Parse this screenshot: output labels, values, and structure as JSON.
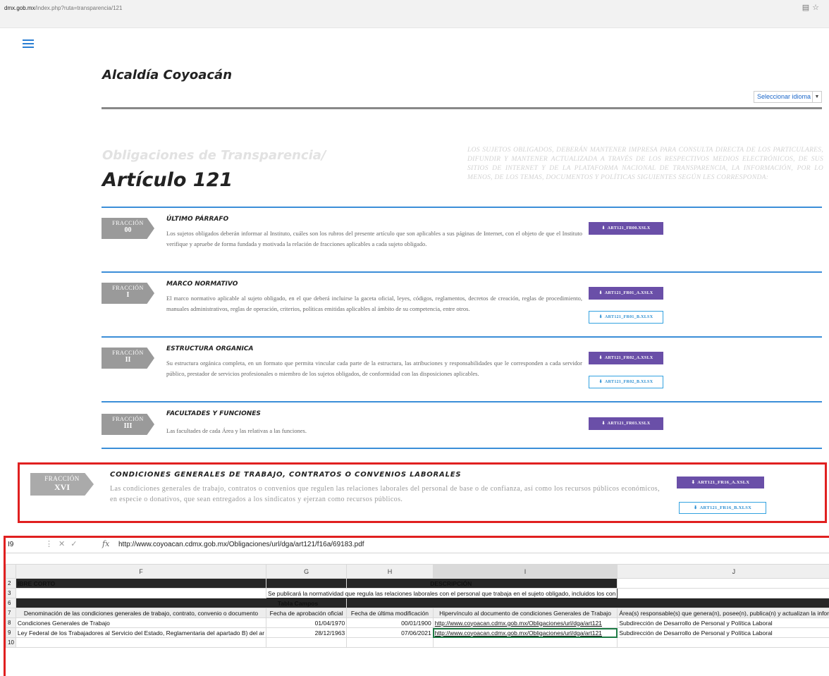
{
  "browser": {
    "url_host": "dmx.gob.mx",
    "url_path": "/index.php?ruta=transparencia/121",
    "icons": [
      "reader-mode-icon",
      "star-icon"
    ]
  },
  "header": {
    "site_title": "Alcaldía Coyoacán",
    "language_select": "Seleccionar idioma"
  },
  "page": {
    "subtitle": "Obligaciones de Transparencia/",
    "title": "Artículo 121",
    "intro": "LOS SUJETOS OBLIGADOS, DEBERÁN MANTENER IMPRESA PARA CONSULTA DIRECTA DE LOS PARTICULARES, DIFUNDIR Y MANTENER ACTUALIZADA A TRAVÉS DE LOS RESPECTIVOS MEDIOS ELECTRÓNICOS, DE SUS SITIOS DE INTERNET Y DE LA PLATAFORMA NACIONAL DE TRANSPARENCIA, LA INFORMACIÓN, POR LO MENOS, DE LOS TEMAS, DOCUMENTOS Y POLÍTICAS SIGUIENTES SEGÚN LES CORRESPONDA:"
  },
  "fractions": [
    {
      "label": "FRACCIÓN",
      "number": "00",
      "title": "ÚLTIMO PÁRRAFO",
      "description": "Los sujetos obligados deberán informar al Instituto, cuáles son los rubros del presente artículo que son aplicables a sus páginas de Internet, con el objeto de que el Instituto verifique y apruebe de forma fundada y motivada la relación de fracciones aplicables a cada sujeto obligado.",
      "buttons": [
        {
          "label": "ART121_FR00.XSLX"
        }
      ]
    },
    {
      "label": "FRACCIÓN",
      "number": "I",
      "title": "MARCO NORMATIVO",
      "description": "El marco normativo aplicable al sujeto obligado, en el que deberá incluirse la gaceta oficial, leyes, códigos, reglamentos, decretos de creación, reglas de procedimiento, manuales administrativos, reglas de operación, criterios, políticas emitidas aplicables al ámbito de su competencia, entre otros.",
      "buttons": [
        {
          "label": "ART121_FR01_A.XSLX"
        },
        {
          "label": "ART121_FR01_B.XLSX"
        }
      ]
    },
    {
      "label": "FRACCIÓN",
      "number": "II",
      "title": "ESTRUCTURA ORGANICA",
      "description": "Su estructura orgánica completa, en un formato que permita vincular cada parte de la estructura, las atribuciones y responsabilidades que le corresponden a cada servidor público, prestador de servicios profesionales o miembro de los sujetos obligados, de conformidad con las disposiciones aplicables.",
      "buttons": [
        {
          "label": "ART121_FR02_A.XSLX"
        },
        {
          "label": "ART121_FR02_B.XLSX"
        }
      ]
    },
    {
      "label": "FRACCIÓN",
      "number": "III",
      "title": "FACULTADES Y FUNCIONES",
      "description": "Las facultades de cada Área y las relativas a las funciones.",
      "buttons": [
        {
          "label": "ART121_FR03.XSLX"
        }
      ]
    }
  ],
  "highlight_fraction": {
    "label": "FRACCIÓN",
    "number": "XVI",
    "title": "CONDICIONES GENERALES DE TRABAJO, CONTRATOS O CONVENIOS LABORALES",
    "description": "Las condiciones generales de trabajo, contratos o convenios que regulen las relaciones laborales del personal de base o de confianza, así como los recursos públicos económicos, en especie o donativos, que sean entregados a los sindicatos y ejerzan como recursos públicos.",
    "buttons": [
      {
        "label": "ART121_FR16_A.XSLX"
      },
      {
        "label": "ART121_FR16_B.XLSX"
      }
    ]
  },
  "spreadsheet": {
    "cell_ref": "I9",
    "formula_controls": [
      "⋮",
      "✕",
      "✓"
    ],
    "fx": "fx",
    "formula": "http://www.coyoacan.cdmx.gob.mx/Obligaciones/url/dga/art121/f16a/69183.pdf",
    "columns": [
      "F",
      "G",
      "H",
      "I",
      "J"
    ],
    "row_numbers": [
      "2",
      "3",
      "6",
      "7",
      "8",
      "9",
      "10"
    ],
    "row2": {
      "left": "IBRE CORTO",
      "right": "DESCRIPCIÓN"
    },
    "row3": "Se publicará la normatividad que regula las relaciones laborales con el personal que trabaja en el sujeto obligado, incluidos los con",
    "row6": "Tabla Campos",
    "headers": [
      "Denominación de las condiciones generales de trabajo, contrato, convenio o documento",
      "Fecha de aprobación oficial",
      "Fecha de última modificación",
      "Hipervínculo al documento de condiciones Generales de Trabajo",
      "Área(s) responsable(s) que genera(n), posee(n), publica(n) y actualizan la información"
    ],
    "rows": [
      [
        "Condiciones Generales de Trabajo",
        "01/04/1970",
        "00/01/1900",
        "http://www.coyoacan.cdmx.gob.mx/Obligaciones/url/dga/art121",
        "Subdirección de Desarrollo de Personal y Política Laboral"
      ],
      [
        "Ley Federal de los Trabajadores al Servicio del Estado, Reglamentaria del apartado B) del ar",
        "28/12/1963",
        "07/06/2021",
        "http://www.coyoacan.cdmx.gob.mx/Obligaciones/url/dga/art121",
        "Subdirección de Desarrollo de Personal y Política Laboral"
      ]
    ]
  }
}
